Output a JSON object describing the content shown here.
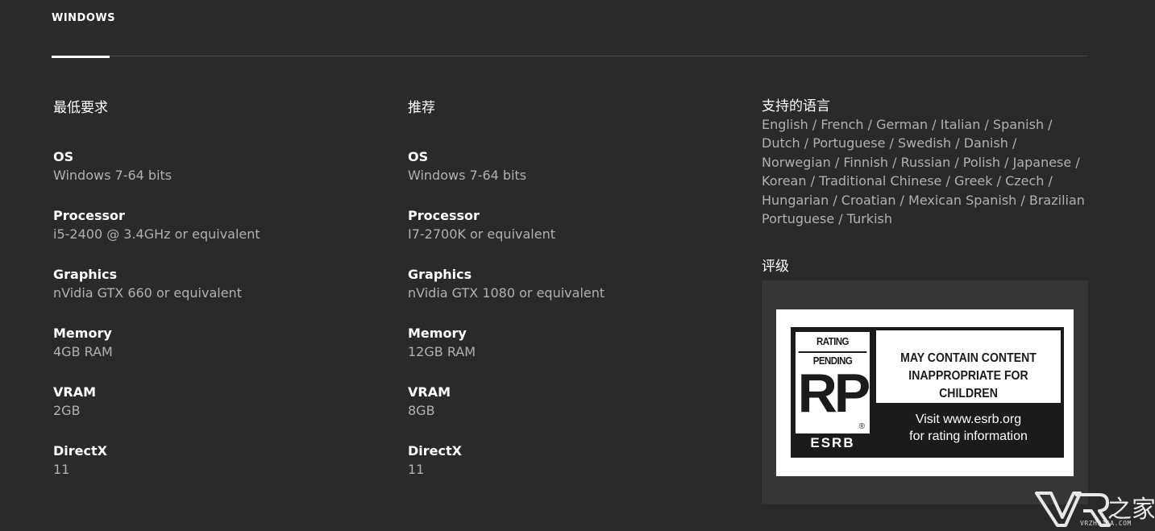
{
  "tabs": [
    {
      "label": "WINDOWS"
    }
  ],
  "minimum": {
    "heading": "最低要求",
    "specs": [
      {
        "label": "OS",
        "value": "Windows 7-64 bits"
      },
      {
        "label": "Processor",
        "value": "i5-2400 @ 3.4GHz or equivalent"
      },
      {
        "label": "Graphics",
        "value": "nVidia GTX 660 or equivalent"
      },
      {
        "label": "Memory",
        "value": "4GB RAM"
      },
      {
        "label": "VRAM",
        "value": "2GB"
      },
      {
        "label": "DirectX",
        "value": "11"
      }
    ]
  },
  "recommended": {
    "heading": "推荐",
    "specs": [
      {
        "label": "OS",
        "value": "Windows 7-64 bits"
      },
      {
        "label": "Processor",
        "value": "I7-2700K or equivalent"
      },
      {
        "label": "Graphics",
        "value": "nVidia GTX 1080 or equivalent"
      },
      {
        "label": "Memory",
        "value": "12GB RAM"
      },
      {
        "label": "VRAM",
        "value": "8GB"
      },
      {
        "label": "DirectX",
        "value": "11"
      }
    ]
  },
  "languages": {
    "heading": "支持的语言",
    "text": "English / French / German / Italian / Spanish / Dutch / Portuguese / Swedish / Danish / Norwegian / Finnish / Russian / Polish / Japanese / Korean / Traditional Chinese / Greek / Czech / Hungarian / Croatian / Mexican Spanish / Brazilian Portuguese / Turkish"
  },
  "rating": {
    "heading": "评级",
    "esrb": {
      "pending_label": "RATING PENDING",
      "rating_code": "RP",
      "registered_mark": "®",
      "brand": "ESRB",
      "warning_line1": "MAY CONTAIN CONTENT",
      "warning_line2": "INAPPROPRIATE FOR CHILDREN",
      "visit_line1": "Visit www.esrb.org",
      "visit_line2": "for rating information"
    }
  },
  "watermark": {
    "logo_text": "VR之家",
    "url": "VRZHIJIA.COM"
  },
  "colors": {
    "background": "#2a2a2a",
    "panel": "#363636",
    "text_primary": "#ffffff",
    "text_secondary": "#b0b0b0",
    "divider": "#454545"
  }
}
